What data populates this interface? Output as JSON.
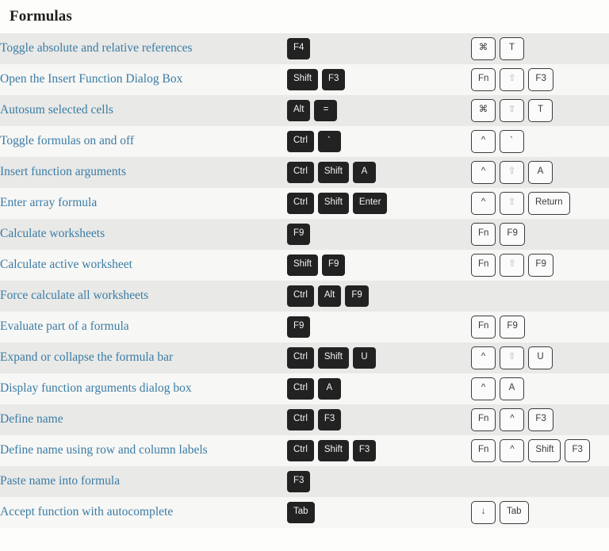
{
  "page": {
    "title": "Formulas"
  },
  "table": {
    "rows": [
      {
        "description": "Toggle absolute and relative references",
        "windows_keys": [
          "F4"
        ],
        "mac_keys": [
          {
            "label": "⌘",
            "dim": false
          },
          {
            "label": "T",
            "dim": false
          }
        ]
      },
      {
        "description": "Open the Insert Function Dialog Box",
        "windows_keys": [
          "Shift",
          "F3"
        ],
        "mac_keys": [
          {
            "label": "Fn",
            "dim": false
          },
          {
            "label": "⇧",
            "dim": true
          },
          {
            "label": "F3",
            "dim": false
          }
        ]
      },
      {
        "description": "Autosum selected cells",
        "windows_keys": [
          "Alt",
          "="
        ],
        "mac_keys": [
          {
            "label": "⌘",
            "dim": false
          },
          {
            "label": "⇧",
            "dim": true
          },
          {
            "label": "T",
            "dim": false
          }
        ]
      },
      {
        "description": "Toggle formulas on and off",
        "windows_keys": [
          "Ctrl",
          "`"
        ],
        "mac_keys": [
          {
            "label": "^",
            "dim": false
          },
          {
            "label": "`",
            "dim": false
          }
        ]
      },
      {
        "description": "Insert function arguments",
        "windows_keys": [
          "Ctrl",
          "Shift",
          "A"
        ],
        "mac_keys": [
          {
            "label": "^",
            "dim": false
          },
          {
            "label": "⇧",
            "dim": true
          },
          {
            "label": "A",
            "dim": false
          }
        ]
      },
      {
        "description": "Enter array formula",
        "windows_keys": [
          "Ctrl",
          "Shift",
          "Enter"
        ],
        "mac_keys": [
          {
            "label": "^",
            "dim": false
          },
          {
            "label": "⇧",
            "dim": true
          },
          {
            "label": "Return",
            "dim": false
          }
        ]
      },
      {
        "description": "Calculate worksheets",
        "windows_keys": [
          "F9"
        ],
        "mac_keys": [
          {
            "label": "Fn",
            "dim": false
          },
          {
            "label": "F9",
            "dim": false
          }
        ]
      },
      {
        "description": "Calculate active worksheet",
        "windows_keys": [
          "Shift",
          "F9"
        ],
        "mac_keys": [
          {
            "label": "Fn",
            "dim": false
          },
          {
            "label": "⇧",
            "dim": true
          },
          {
            "label": "F9",
            "dim": false
          }
        ]
      },
      {
        "description": "Force calculate all worksheets",
        "windows_keys": [
          "Ctrl",
          "Alt",
          "F9"
        ],
        "mac_keys": []
      },
      {
        "description": "Evaluate part of a formula",
        "windows_keys": [
          "F9"
        ],
        "mac_keys": [
          {
            "label": "Fn",
            "dim": false
          },
          {
            "label": "F9",
            "dim": false
          }
        ]
      },
      {
        "description": "Expand or collapse the formula bar",
        "windows_keys": [
          "Ctrl",
          "Shift",
          "U"
        ],
        "mac_keys": [
          {
            "label": "^",
            "dim": false
          },
          {
            "label": "⇧",
            "dim": true
          },
          {
            "label": "U",
            "dim": false
          }
        ]
      },
      {
        "description": "Display function arguments dialog box",
        "windows_keys": [
          "Ctrl",
          "A"
        ],
        "mac_keys": [
          {
            "label": "^",
            "dim": false
          },
          {
            "label": "A",
            "dim": false
          }
        ]
      },
      {
        "description": "Define name",
        "windows_keys": [
          "Ctrl",
          "F3"
        ],
        "mac_keys": [
          {
            "label": "Fn",
            "dim": false
          },
          {
            "label": "^",
            "dim": false
          },
          {
            "label": "F3",
            "dim": false
          }
        ]
      },
      {
        "description": "Define name using row and column labels",
        "windows_keys": [
          "Ctrl",
          "Shift",
          "F3"
        ],
        "mac_keys": [
          {
            "label": "Fn",
            "dim": false
          },
          {
            "label": "^",
            "dim": false
          },
          {
            "label": "Shift",
            "dim": false
          },
          {
            "label": "F3",
            "dim": false
          }
        ]
      },
      {
        "description": "Paste name into formula",
        "windows_keys": [
          "F3"
        ],
        "mac_keys": []
      },
      {
        "description": "Accept function with autocomplete",
        "windows_keys": [
          "Tab"
        ],
        "mac_keys": [
          {
            "label": "↓",
            "dim": false
          },
          {
            "label": "Tab",
            "dim": false
          }
        ]
      }
    ]
  },
  "colors": {
    "link": "#3a7ca5",
    "row_odd": "#e9e9e7",
    "row_even": "#f7f7f5",
    "win_key_bg": "#222222",
    "mac_key_border": "#3c3c3c",
    "title": "#20201e"
  }
}
